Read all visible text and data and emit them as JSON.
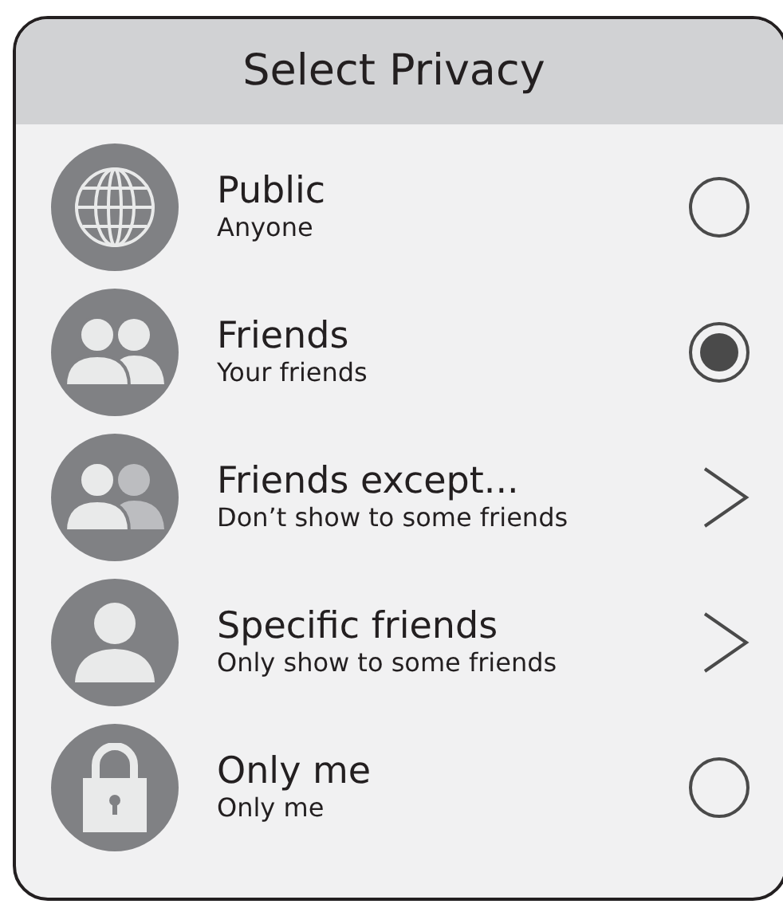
{
  "title": "Select Privacy",
  "options": [
    {
      "kind": "radio",
      "label": "Public",
      "description": "Anyone",
      "selected": false
    },
    {
      "kind": "radio",
      "label": "Friends",
      "description": "Your friends",
      "selected": true
    },
    {
      "kind": "submenu",
      "label": "Friends except...",
      "description": "Don’t show to some friends"
    },
    {
      "kind": "submenu",
      "label": "Specific friends",
      "description": "Only show to some friends"
    },
    {
      "kind": "radio",
      "label": "Only me",
      "description": "Only me",
      "selected": false
    }
  ]
}
